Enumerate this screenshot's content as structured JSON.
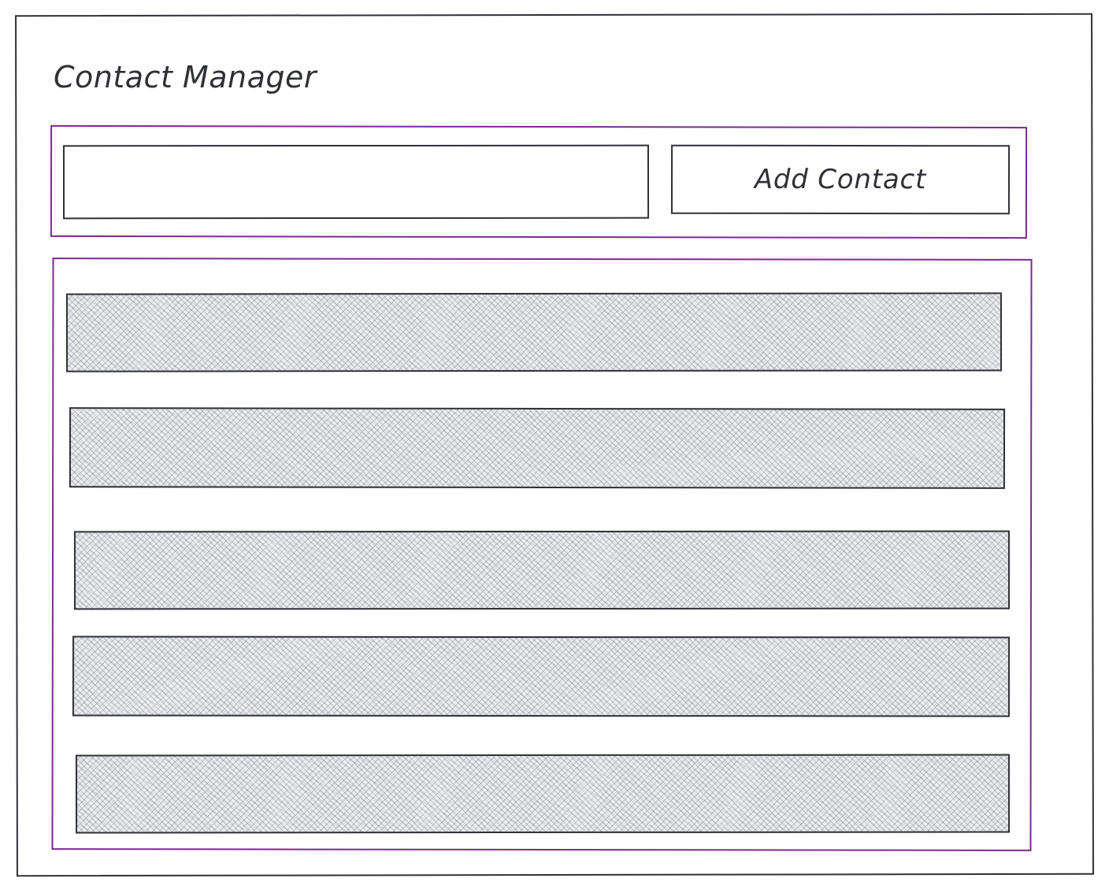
{
  "page": {
    "title": "Contact Manager"
  },
  "toolbar": {
    "input_value": "",
    "add_button_label": "Add Contact"
  },
  "contacts": {
    "rows": [
      {
        "label": ""
      },
      {
        "label": ""
      },
      {
        "label": ""
      },
      {
        "label": ""
      },
      {
        "label": ""
      }
    ]
  },
  "colors": {
    "frame": "#2f3136",
    "accent_border": "#7b2a8f",
    "row_fill": "#ebecef"
  }
}
